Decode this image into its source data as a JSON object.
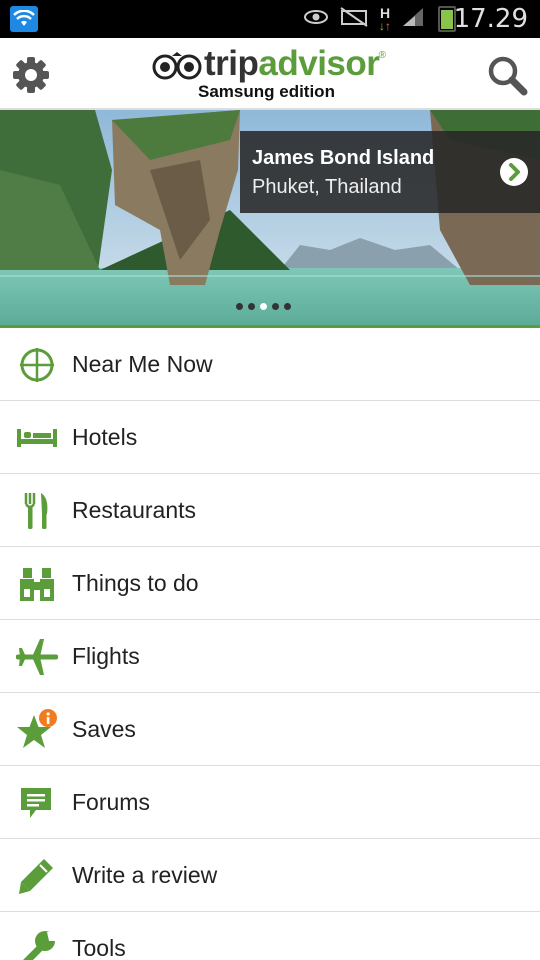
{
  "status_bar": {
    "time": "17.29",
    "icons": [
      "wifi-icon",
      "eye-icon",
      "mute-icon",
      "h-data-icon",
      "signal-icon",
      "battery-icon"
    ],
    "network_letter": "H"
  },
  "header": {
    "brand_trip": "trip",
    "brand_advisor": "advisor",
    "brand_registered": "®",
    "edition": "Samsung edition",
    "accent_color": "#5b9d3a"
  },
  "hero": {
    "title": "James Bond Island",
    "subtitle": "Phuket, Thailand",
    "dots_count": 5,
    "active_dot": 2
  },
  "menu": {
    "items": [
      {
        "label": "Near Me Now",
        "icon": "crosshair-icon"
      },
      {
        "label": "Hotels",
        "icon": "bed-icon"
      },
      {
        "label": "Restaurants",
        "icon": "fork-knife-icon"
      },
      {
        "label": "Things to do",
        "icon": "binoculars-icon"
      },
      {
        "label": "Flights",
        "icon": "airplane-icon"
      },
      {
        "label": "Saves",
        "icon": "star-icon",
        "badge": "i"
      },
      {
        "label": "Forums",
        "icon": "speech-bubble-icon"
      },
      {
        "label": "Write a review",
        "icon": "pencil-icon"
      },
      {
        "label": "Tools",
        "icon": "wrench-icon"
      }
    ]
  }
}
